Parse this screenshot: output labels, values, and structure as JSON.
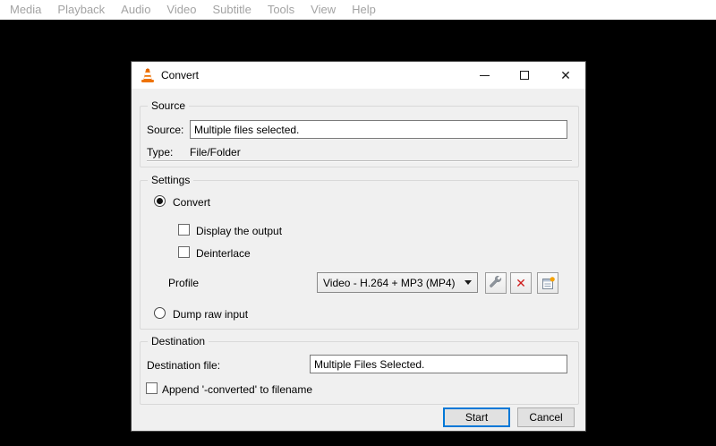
{
  "menubar": {
    "items": [
      "Media",
      "Playback",
      "Audio",
      "Video",
      "Subtitle",
      "Tools",
      "View",
      "Help"
    ]
  },
  "dialog": {
    "title": "Convert",
    "window_controls": {
      "close": "✕"
    },
    "source": {
      "group_label": "Source",
      "source_label": "Source:",
      "source_value": "Multiple files selected.",
      "type_label": "Type:",
      "type_value": "File/Folder"
    },
    "settings": {
      "group_label": "Settings",
      "convert_label": "Convert",
      "display_output_label": "Display the output",
      "deinterlace_label": "Deinterlace",
      "profile_label": "Profile",
      "profile_value": "Video - H.264 + MP3 (MP4)",
      "delete_icon": "✕",
      "dump_raw_label": "Dump raw input"
    },
    "destination": {
      "group_label": "Destination",
      "file_label": "Destination file:",
      "file_value": "Multiple Files Selected.",
      "append_label": "Append '-converted' to filename"
    },
    "buttons": {
      "start": "Start",
      "cancel": "Cancel"
    }
  },
  "colors": {
    "accent": "#0078d7",
    "delete-red": "#cf1d1d",
    "cone-orange": "#ee7203",
    "badge-orange": "#f5a100"
  }
}
